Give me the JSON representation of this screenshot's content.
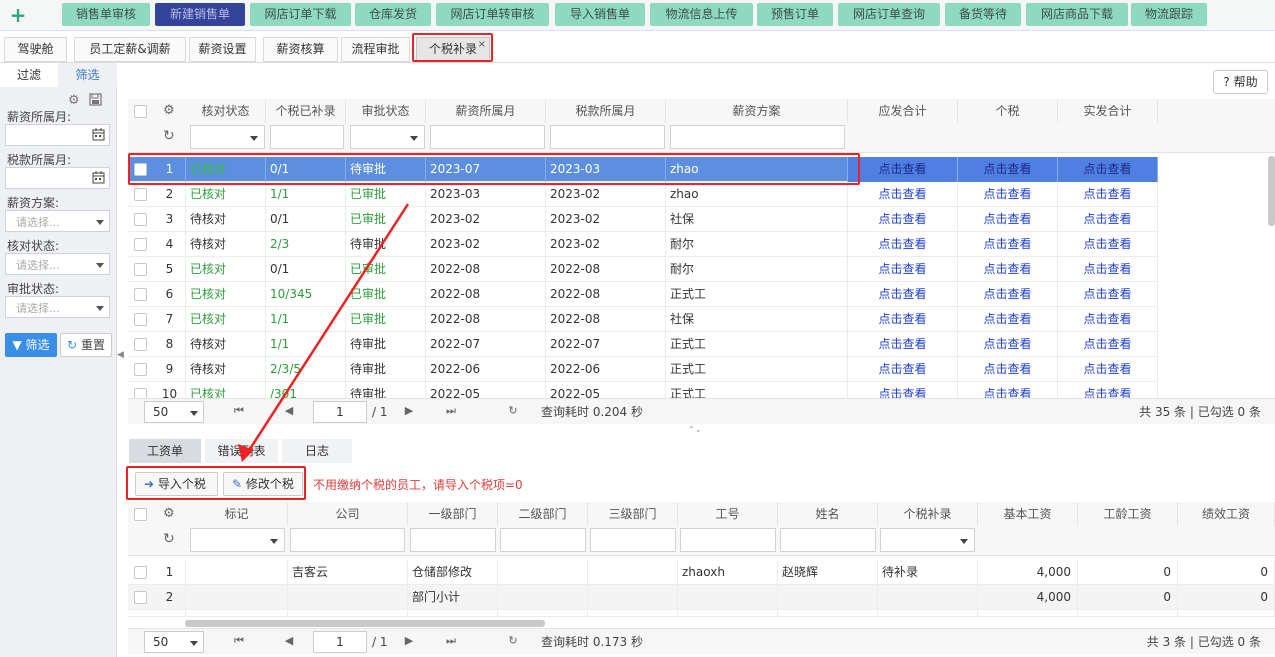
{
  "topbar": {
    "plus": "+",
    "buttons": [
      {
        "label": "销售单审核",
        "active": false
      },
      {
        "label": "新建销售单",
        "active": true
      },
      {
        "label": "网店订单下载",
        "active": false
      },
      {
        "label": "仓库发货",
        "active": false
      },
      {
        "label": "网店订单转审核",
        "active": false
      },
      {
        "label": "导入销售单",
        "active": false
      },
      {
        "label": "物流信息上传",
        "active": false
      },
      {
        "label": "预售订单",
        "active": false
      },
      {
        "label": "网店订单查询",
        "active": false
      },
      {
        "label": "备货等待",
        "active": false
      },
      {
        "label": "网店商品下载",
        "active": false
      },
      {
        "label": "物流跟踪",
        "active": false
      }
    ]
  },
  "tabs": [
    "驾驶舱",
    "员工定薪&调薪",
    "薪资设置",
    "薪资核算",
    "流程审批",
    "个税补录"
  ],
  "tab_close": "×",
  "left": {
    "tab_filter": "过滤",
    "tab_select": "筛选",
    "fields": [
      {
        "label": "薪资所属月:",
        "placeholder": "",
        "type": "date"
      },
      {
        "label": "税款所属月:",
        "placeholder": "",
        "type": "date"
      },
      {
        "label": "薪资方案:",
        "placeholder": "请选择...",
        "type": "select"
      },
      {
        "label": "核对状态:",
        "placeholder": "请选择...",
        "type": "select"
      },
      {
        "label": "审批状态:",
        "placeholder": "请选择...",
        "type": "select"
      }
    ],
    "filter_button": "筛选",
    "reset_button": "重置"
  },
  "help_button": "帮助",
  "top_grid": {
    "columns": [
      "核对状态",
      "个税已补录",
      "审批状态",
      "薪资所属月",
      "税款所属月",
      "薪资方案",
      "应发合计",
      "个税",
      "实发合计"
    ],
    "link_text": "点击查看",
    "rows": [
      {
        "n": "1",
        "check": "已核对",
        "tax": "0/1",
        "approve": "待审批",
        "salary_month": "2023-07",
        "tax_month": "2023-03",
        "plan": "zhao"
      },
      {
        "n": "2",
        "check": "已核对",
        "tax": "1/1",
        "approve": "已审批",
        "salary_month": "2023-03",
        "tax_month": "2023-02",
        "plan": "zhao"
      },
      {
        "n": "3",
        "check": "待核对",
        "tax": "0/1",
        "approve": "已审批",
        "salary_month": "2023-02",
        "tax_month": "2023-02",
        "plan": "社保"
      },
      {
        "n": "4",
        "check": "待核对",
        "tax": "2/3",
        "approve": "待审批",
        "salary_month": "2023-02",
        "tax_month": "2023-02",
        "plan": "耐尔"
      },
      {
        "n": "5",
        "check": "已核对",
        "tax": "0/1",
        "approve": "已审批",
        "salary_month": "2022-08",
        "tax_month": "2022-08",
        "plan": "耐尔"
      },
      {
        "n": "6",
        "check": "已核对",
        "tax": "10/345",
        "approve": "已审批",
        "salary_month": "2022-08",
        "tax_month": "2022-08",
        "plan": "正式工"
      },
      {
        "n": "7",
        "check": "已核对",
        "tax": "1/1",
        "approve": "已审批",
        "salary_month": "2022-08",
        "tax_month": "2022-08",
        "plan": "社保"
      },
      {
        "n": "8",
        "check": "待核对",
        "tax": "1/1",
        "approve": "待审批",
        "salary_month": "2022-07",
        "tax_month": "2022-07",
        "plan": "正式工"
      },
      {
        "n": "9",
        "check": "待核对",
        "tax": "2/3/5",
        "approve": "待审批",
        "salary_month": "2022-06",
        "tax_month": "2022-06",
        "plan": "正式工"
      },
      {
        "n": "10",
        "check": "已核对",
        "tax": "/301",
        "approve": "待审批",
        "salary_month": "2022-05",
        "tax_month": "2022-05",
        "plan": "正式工"
      }
    ],
    "pager": {
      "size": "50",
      "page": "1",
      "total_pages": "/ 1",
      "time": "查询耗时 0.204 秒",
      "summary": "共 35 条 | 已勾选 0 条"
    }
  },
  "bottom_tabs": [
    "工资单",
    "错误列表",
    "日志"
  ],
  "toolbar": {
    "import": "导入个税",
    "edit": "修改个税",
    "warning": "不用缴纳个税的员工，请导入个税项=0"
  },
  "bottom_grid": {
    "columns": [
      "标记",
      "公司",
      "一级部门",
      "二级部门",
      "三级部门",
      "工号",
      "姓名",
      "个税补录",
      "基本工资",
      "工龄工资",
      "绩效工资"
    ],
    "rows": [
      {
        "n": "1",
        "mark": "",
        "company": "吉客云",
        "dept1": "仓储部修改",
        "dept2": "",
        "dept3": "",
        "id": "zhaoxh",
        "name": "赵晓辉",
        "taxrec": "待补录",
        "base": "4,000",
        "seniority": "0",
        "perf": "0"
      },
      {
        "n": "2",
        "mark": "",
        "company": "",
        "dept1": "部门小计",
        "dept2": "",
        "dept3": "",
        "id": "",
        "name": "",
        "taxrec": "",
        "base": "4,000",
        "seniority": "0",
        "perf": "0"
      },
      {
        "n": "3",
        "mark": "",
        "company": "",
        "dept1": "",
        "dept2": "",
        "dept3": "",
        "id": "",
        "name": "",
        "taxrec": "",
        "base": "",
        "seniority": "",
        "perf": ""
      }
    ],
    "pager": {
      "size": "50",
      "page": "1",
      "total_pages": "/ 1",
      "time": "查询耗时 0.173 秒",
      "summary": "共 3 条 | 已勾选 0 条"
    }
  },
  "colors": {
    "accent": "#8fd9c0",
    "active": "#34449a",
    "selection": "#5d8fe0",
    "highlight": "#e22222",
    "link": "#1d3fd8"
  }
}
